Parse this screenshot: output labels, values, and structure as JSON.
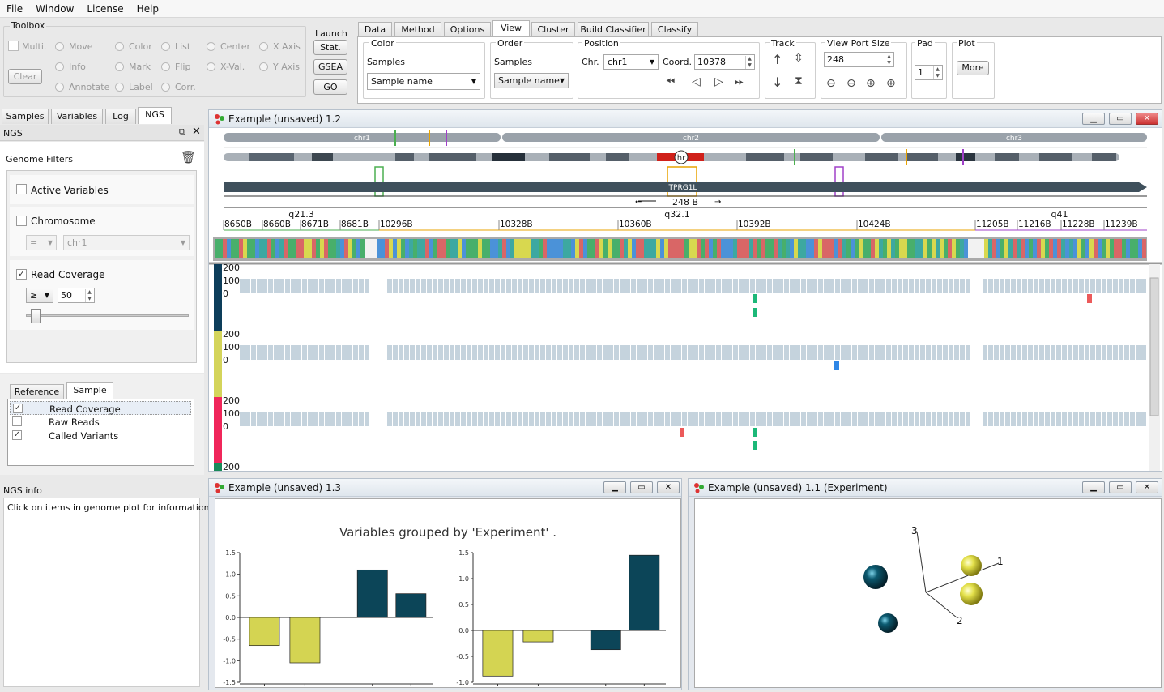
{
  "menu": [
    "File",
    "Window",
    "License",
    "Help"
  ],
  "toolbox": {
    "title": "Toolbox",
    "multi": "Multi.",
    "clear": "Clear",
    "radios": [
      [
        "Move",
        "Color",
        "List",
        "Center",
        "X Axis"
      ],
      [
        "Info",
        "Mark",
        "Flip",
        "X-Val.",
        "Y Axis"
      ],
      [
        "Annotate",
        "Label",
        "Corr."
      ]
    ]
  },
  "launch": {
    "title": "Launch",
    "buttons": [
      "Stat.",
      "GSEA",
      "GO"
    ]
  },
  "tabs": [
    "Data",
    "Method",
    "Options",
    "View",
    "Cluster",
    "Build Classifier",
    "Classify"
  ],
  "active_tab": "View",
  "view": {
    "color_title": "Color",
    "color_samples": "Samples",
    "color_combo": "Sample name",
    "order_title": "Order",
    "order_samples": "Samples",
    "order_combo": "Sample name",
    "position_title": "Position",
    "chr_label": "Chr.",
    "chr_value": "chr1",
    "coord_label": "Coord.",
    "coord_value": "10378",
    "track_title": "Track",
    "viewport_title": "View Port Size",
    "viewport_value": "248",
    "pad_title": "Pad",
    "pad_value": "1",
    "plot_title": "Plot",
    "more": "More"
  },
  "left_tabs": [
    "Samples",
    "Variables",
    "Log",
    "NGS"
  ],
  "ngs": {
    "header": "NGS",
    "genome_filters": "Genome Filters",
    "active_variables": "Active Variables",
    "chromosome": "Chromosome",
    "chr_op": "=",
    "chr_value": "chr1",
    "read_coverage": "Read Coverage",
    "op": "≥",
    "value": "50",
    "slider_value": 50
  },
  "sample_tabs": [
    "Reference",
    "Sample"
  ],
  "sample_items": [
    {
      "label": "Read Coverage",
      "checked": true
    },
    {
      "label": "Raw Reads",
      "checked": false
    },
    {
      "label": "Called Variants",
      "checked": true
    }
  ],
  "ngs_info": {
    "title": "NGS info",
    "text": "Click on items in genome plot for information."
  },
  "genome_window": {
    "title": "Example (unsaved) 1.2",
    "chromosomes": [
      "chr1",
      "chr2",
      "chr3"
    ],
    "gene": "TPRG1L",
    "band_marker": "hr",
    "scale": "248 B",
    "bands": [
      "q21.3",
      "q32.1",
      "q41"
    ],
    "positions": [
      "8650B",
      "8660B",
      "8671B",
      "8681B",
      "10296B",
      "10328B",
      "10360B",
      "10392B",
      "10424B",
      "11205B",
      "11216B",
      "11228B",
      "11239B"
    ],
    "coverage_ticks": [
      "200",
      "100",
      "0"
    ],
    "last_tick": "200",
    "track_colors": [
      "#0d3d5a",
      "#d4d45a",
      "#f0265a"
    ]
  },
  "bar_window": {
    "title": "Example (unsaved) 1.3",
    "heading": "Variables grouped by 'Experiment' .",
    "colors": {
      "yellow": "#d4d452",
      "teal": "#0c4558"
    }
  },
  "scatter_window": {
    "title": "Example (unsaved) 1.1 (Experiment)",
    "axes": [
      "1",
      "2",
      "3"
    ]
  },
  "chart_data": [
    {
      "type": "bar",
      "title": "",
      "categories": [
        "",
        "",
        "",
        ""
      ],
      "values": [
        -0.65,
        -1.05,
        1.1,
        0.55
      ],
      "ylim": [
        -1.5,
        1.5
      ],
      "yticks": [
        "1.5",
        "1.0",
        "0.5",
        "0.0",
        "-0.5",
        "-1.0",
        "-1.5"
      ]
    },
    {
      "type": "bar",
      "title": "",
      "categories": [
        "",
        "",
        "",
        ""
      ],
      "values": [
        -0.88,
        -0.22,
        -0.37,
        1.45
      ],
      "ylim": [
        -1.0,
        1.5
      ],
      "yticks": [
        "1.5",
        "1.0",
        "0.5",
        "0.0",
        "-0.5",
        "-1.0"
      ]
    }
  ]
}
